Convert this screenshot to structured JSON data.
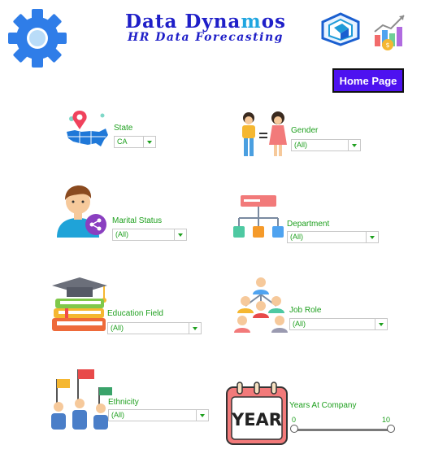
{
  "header": {
    "title_part1": "Data Dyna",
    "title_part2": "m",
    "title_part3": "os",
    "subtitle": "HR Data Forecasting",
    "home_button": "Home Page"
  },
  "filters": {
    "state": {
      "label": "State",
      "value": "CA"
    },
    "gender": {
      "label": "Gender",
      "value": "(All)"
    },
    "marital_status": {
      "label": "Marital Status",
      "value": "(All)"
    },
    "department": {
      "label": "Department",
      "value": "(All)"
    },
    "education_field": {
      "label": "Education Field",
      "value": "(All)"
    },
    "job_role": {
      "label": "Job Role",
      "value": "(All)"
    },
    "ethnicity": {
      "label": "Ethnicity",
      "value": "(All)"
    },
    "years_at_company": {
      "label": "Years At Company",
      "min": "0",
      "max": "10"
    }
  },
  "icons": {
    "settings": "gear-icon",
    "logo": "cube-logo-icon",
    "analytics": "chart-icon",
    "state": "map-pin-icon",
    "gender": "people-icon",
    "marital": "person-icon",
    "department": "org-chart-icon",
    "education": "books-icon",
    "job_role": "team-icon",
    "ethnicity": "flags-icon",
    "years": "calendar-icon"
  },
  "colors": {
    "title": "#1f1fc8",
    "button": "#4d12f0",
    "label": "#1fa01f"
  }
}
